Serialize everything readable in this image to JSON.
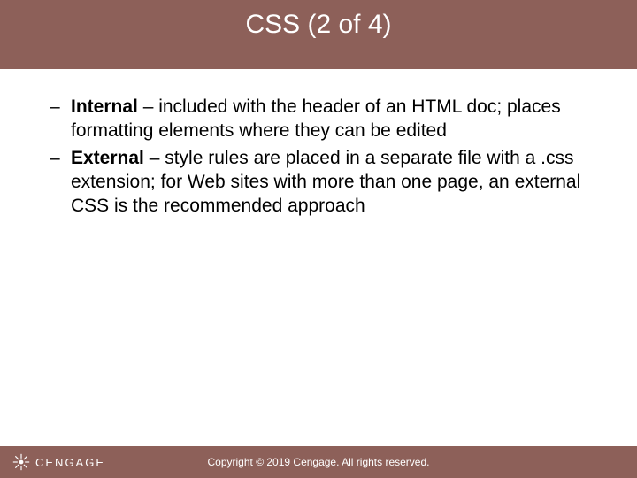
{
  "title": "CSS (2 of 4)",
  "bullets": [
    {
      "label": "Internal",
      "text": " – included with the header of an HTML doc; places formatting elements where they can be edited"
    },
    {
      "label": "External",
      "text": " – style rules are placed in a separate file with a .css extension; for Web sites with more than one page, an external CSS is the recommended approach"
    }
  ],
  "footer": {
    "brand": "CENGAGE",
    "copyright": "Copyright © 2019 Cengage. All rights reserved."
  }
}
